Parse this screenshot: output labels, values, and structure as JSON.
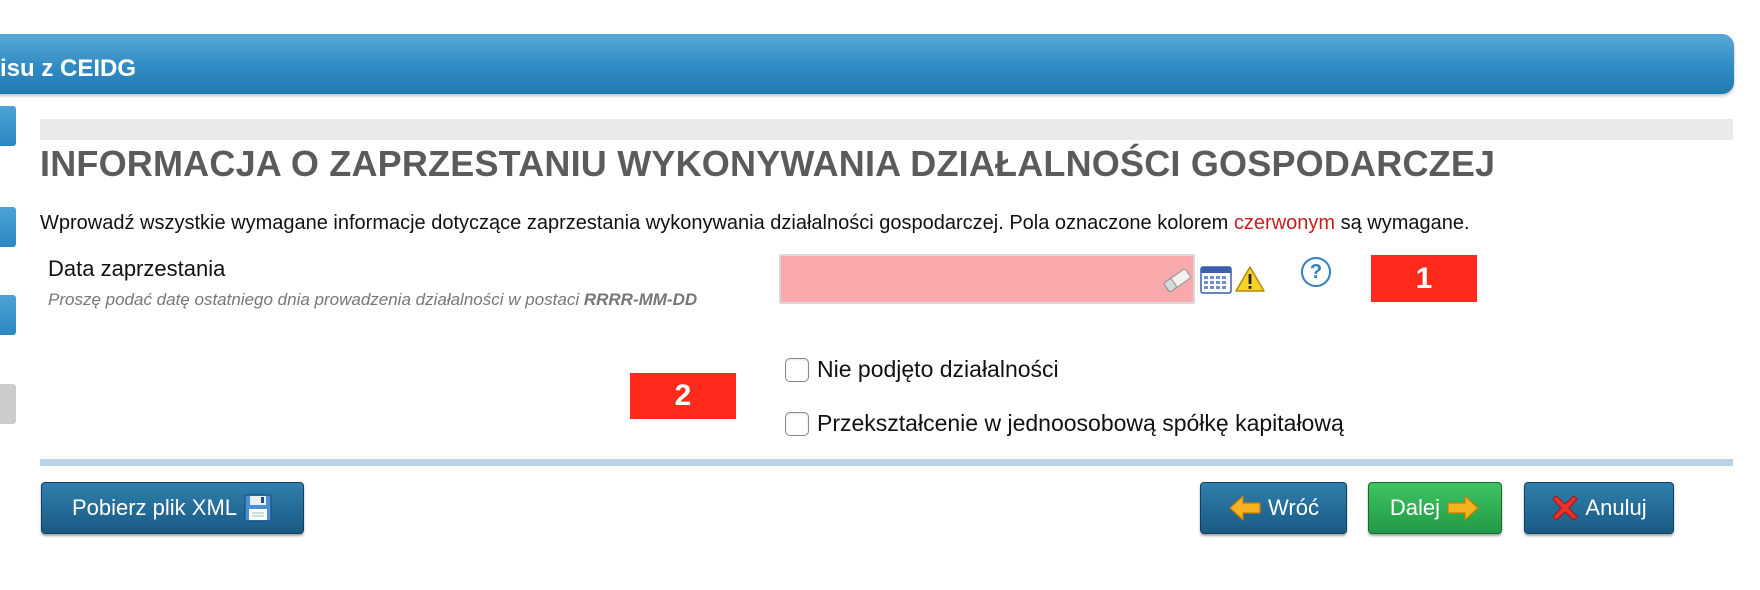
{
  "header": {
    "title": "isu z CEIDG"
  },
  "form": {
    "title": "INFORMACJA O ZAPRZESTANIU WYKONYWANIA DZIAŁALNOŚCI GOSPODARCZEJ",
    "intro_before": "Wprowadź wszystkie wymagane informacje dotyczące zaprzestania wykonywania działalności gospodarczej. Pola oznaczone kolorem ",
    "intro_highlight": "czerwonym",
    "intro_after": " są wymagane.",
    "date_field": {
      "label": "Data zaprzestania",
      "hint_text": "Proszę podać datę ostatniego dnia prowadzenia działalności w postaci ",
      "hint_format": "RRRR-MM-DD",
      "value": "",
      "placeholder": ""
    },
    "help_glyph": "?",
    "checkboxes": [
      {
        "label": "Nie podjęto działalności",
        "checked": false
      },
      {
        "label": "Przekształcenie w jednoosobową spółkę kapitałową",
        "checked": false
      }
    ]
  },
  "markers": {
    "marker_1": "1",
    "marker_2": "2"
  },
  "buttons": {
    "xml": "Pobierz plik XML",
    "back": "Wróć",
    "next": "Dalej",
    "cancel": "Anuluj"
  },
  "colors": {
    "header_blue": "#2f8bc3",
    "required_field": "#f9a9ab",
    "required_text": "#c81e1e",
    "marker_red": "#ff2a1c",
    "button_dark": "#1a5a85",
    "button_green": "#229a45"
  },
  "icons": [
    "eraser-icon",
    "calendar-icon",
    "warning-icon",
    "help-icon",
    "floppy-disk-icon",
    "arrow-left-icon",
    "arrow-right-icon",
    "cross-icon"
  ]
}
